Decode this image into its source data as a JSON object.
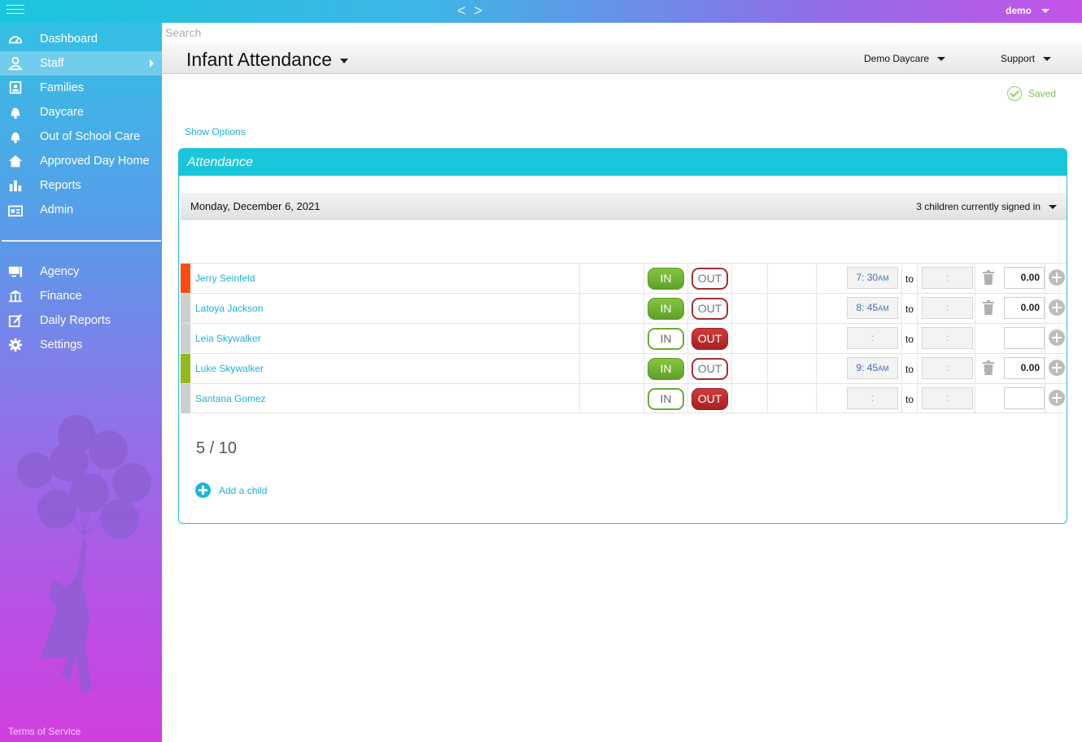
{
  "topbar": {
    "user": "demo",
    "nav_prev": "<",
    "nav_next": ">"
  },
  "sidebar": {
    "items": [
      {
        "label": "Dashboard",
        "icon": "gauge-icon"
      },
      {
        "label": "Staff",
        "icon": "user-icon",
        "active": true
      },
      {
        "label": "Families",
        "icon": "families-icon"
      },
      {
        "label": "Daycare",
        "icon": "bell-icon"
      },
      {
        "label": "Out of School Care",
        "icon": "bell-icon"
      },
      {
        "label": "Approved Day Home",
        "icon": "house-icon"
      },
      {
        "label": "Reports",
        "icon": "bar-chart-icon"
      },
      {
        "label": "Admin",
        "icon": "id-card-icon"
      }
    ],
    "items2": [
      {
        "label": "Agency",
        "icon": "monitor-icon"
      },
      {
        "label": "Finance",
        "icon": "bank-icon"
      },
      {
        "label": "Daily Reports",
        "icon": "edit-icon"
      },
      {
        "label": "Settings",
        "icon": "gear-icon"
      }
    ],
    "terms": "Terms of Service"
  },
  "search": {
    "placeholder": "Search"
  },
  "header": {
    "title": "Infant Attendance",
    "org": "Demo Daycare",
    "support": "Support"
  },
  "status": {
    "saved": "Saved"
  },
  "options": {
    "show": "Show Options"
  },
  "panel": {
    "title": "Attendance",
    "date": "Monday, December 6, 2021",
    "signed_in": "3 children currently signed in",
    "in_label": "IN",
    "out_label": "OUT",
    "to_label": "to",
    "rows": [
      {
        "name": "Jerry Seinfeld",
        "color": "#ff4a12",
        "status": "in",
        "from": "7: 30",
        "from_ampm": "AM",
        "to": ":",
        "hours": "0.00"
      },
      {
        "name": "Latoya Jackson",
        "color": "#cfcfcf",
        "status": "in",
        "from": "8: 45",
        "from_ampm": "AM",
        "to": ":",
        "hours": "0.00"
      },
      {
        "name": "Leia Skywalker",
        "color": "#cfcfcf",
        "status": "out",
        "from": ":",
        "from_ampm": "",
        "to": ":",
        "hours": ""
      },
      {
        "name": "Luke Skywalker",
        "color": "#95b81a",
        "status": "in",
        "from": "9: 45",
        "from_ampm": "AM",
        "to": ":",
        "hours": "0.00"
      },
      {
        "name": "Santana Gomez",
        "color": "#cfcfcf",
        "status": "out",
        "from": ":",
        "from_ampm": "",
        "to": ":",
        "hours": ""
      }
    ],
    "capacity": "5 / 10",
    "add_child": "Add a child"
  },
  "colors": {
    "accent": "#19c6dc",
    "in_green": "#6aaa35",
    "out_red": "#a82222",
    "link": "#1fb2d3"
  }
}
